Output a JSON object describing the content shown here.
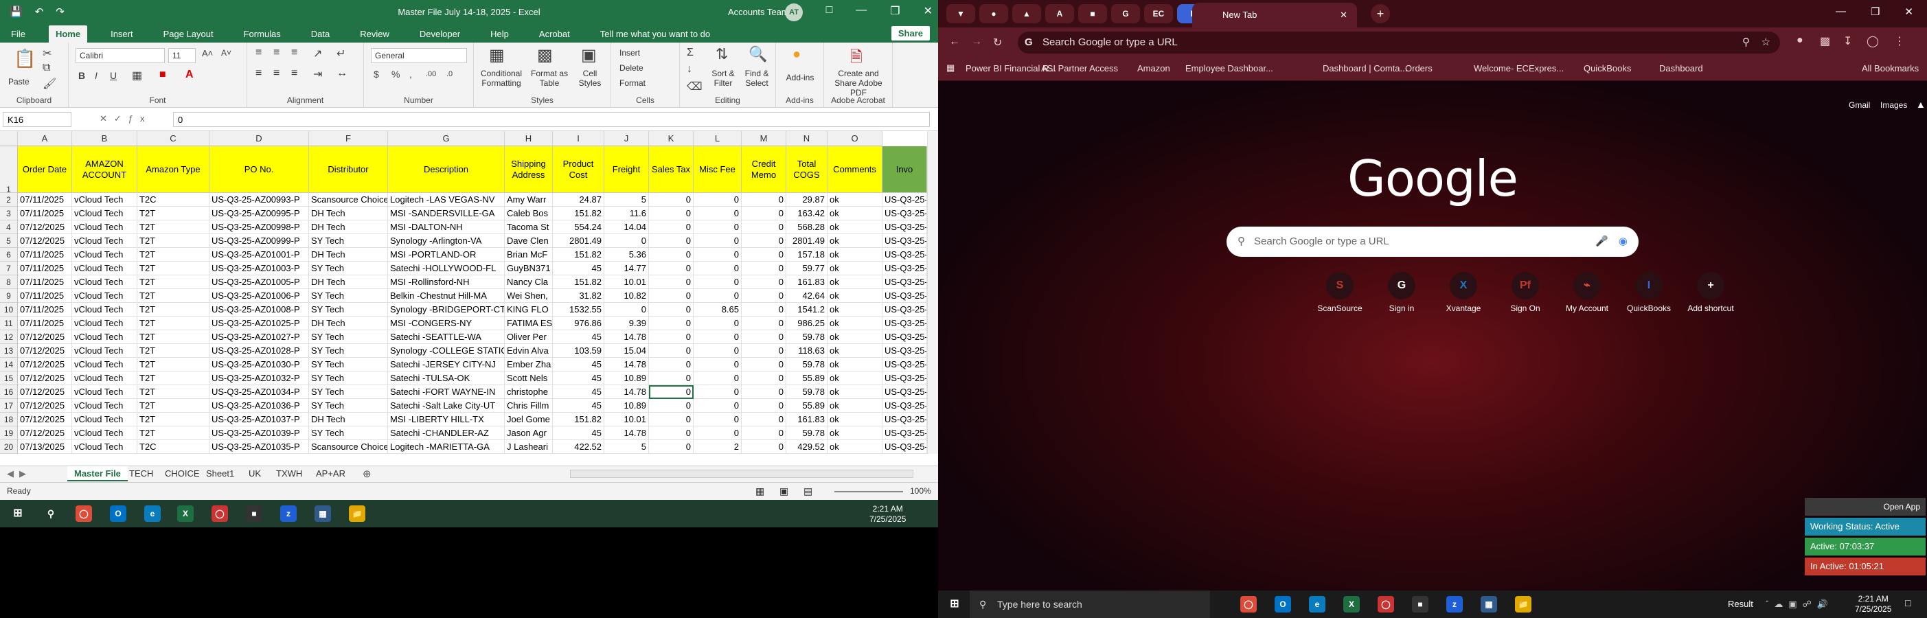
{
  "excel": {
    "title": "Master File July 14-18, 2025  -  Excel",
    "user": "Accounts Team",
    "avatar": "AT",
    "tabs": [
      "File",
      "Home",
      "Insert",
      "Page Layout",
      "Formulas",
      "Data",
      "Review",
      "Developer",
      "Help",
      "Acrobat"
    ],
    "tell_me": "Tell me what you want to do",
    "share": "Share",
    "ribbon": {
      "font": "Calibri",
      "size": "11",
      "number_format": "General",
      "groups": [
        "Clipboard",
        "Font",
        "Alignment",
        "Number",
        "Styles",
        "Cells",
        "Editing",
        "Add-ins",
        "Adobe Acrobat"
      ],
      "buttons": {
        "paste": "Paste",
        "cond": "Conditional Formatting",
        "format_table": "Format as Table",
        "cell_styles": "Cell Styles",
        "insert": "Insert",
        "delete": "Delete",
        "format": "Format",
        "sort": "Sort & Filter",
        "find": "Find & Select",
        "addins": "Add-ins",
        "acrobat": "Create and Share Adobe PDF"
      }
    },
    "namebox": "K16",
    "formula": "0",
    "columns": [
      "A",
      "B",
      "C",
      "D",
      "F",
      "G",
      "H",
      "I",
      "J",
      "K",
      "L",
      "M",
      "N",
      "O"
    ],
    "headers": [
      "Order Date",
      "AMAZON ACCOUNT",
      "Amazon Type",
      "PO No.",
      "Distributor",
      "Description",
      "Shipping Address",
      "Product Cost",
      "Freight",
      "Sales Tax",
      "Misc Fee",
      "Credit Memo",
      "Total COGS",
      "Comments",
      "Invo"
    ],
    "rows": [
      [
        "07/11/2025",
        "vCloud Tech",
        "T2C",
        "US-Q3-25-AZ00993-P",
        "Scansource Choice",
        "Logitech -LAS VEGAS-NV",
        "Amy Warr",
        "24.87",
        "5",
        "0",
        "0",
        "0",
        "29.87",
        "ok",
        "US-Q3-25-A"
      ],
      [
        "07/11/2025",
        "vCloud Tech",
        "T2T",
        "US-Q3-25-AZ00995-P",
        "DH Tech",
        "MSI -SANDERSVILLE-GA",
        "Caleb Bos",
        "151.82",
        "11.6",
        "0",
        "0",
        "0",
        "163.42",
        "ok",
        "US-Q3-25-A"
      ],
      [
        "07/12/2025",
        "vCloud Tech",
        "T2T",
        "US-Q3-25-AZ00998-P",
        "DH Tech",
        "MSI -DALTON-NH",
        "Tacoma St",
        "554.24",
        "14.04",
        "0",
        "0",
        "0",
        "568.28",
        "ok",
        "US-Q3-25-A"
      ],
      [
        "07/12/2025",
        "vCloud Tech",
        "T2T",
        "US-Q3-25-AZ00999-P",
        "SY Tech",
        "Synology -Arlington-VA",
        "Dave Clen",
        "2801.49",
        "0",
        "0",
        "0",
        "0",
        "2801.49",
        "ok",
        "US-Q3-25-A"
      ],
      [
        "07/11/2025",
        "vCloud Tech",
        "T2T",
        "US-Q3-25-AZ01001-P",
        "DH Tech",
        "MSI -PORTLAND-OR",
        "Brian McF",
        "151.82",
        "5.36",
        "0",
        "0",
        "0",
        "157.18",
        "ok",
        "US-Q3-25-A"
      ],
      [
        "07/11/2025",
        "vCloud Tech",
        "T2T",
        "US-Q3-25-AZ01003-P",
        "SY Tech",
        "Satechi -HOLLYWOOD-FL",
        "GuyBN371",
        "45",
        "14.77",
        "0",
        "0",
        "0",
        "59.77",
        "ok",
        "US-Q3-25-A"
      ],
      [
        "07/11/2025",
        "vCloud Tech",
        "T2T",
        "US-Q3-25-AZ01005-P",
        "DH Tech",
        "MSI -Rollinsford-NH",
        "Nancy Cla",
        "151.82",
        "10.01",
        "0",
        "0",
        "0",
        "161.83",
        "ok",
        "US-Q3-25-A"
      ],
      [
        "07/11/2025",
        "vCloud Tech",
        "T2T",
        "US-Q3-25-AZ01006-P",
        "SY Tech",
        "Belkin -Chestnut Hill-MA",
        "Wei Shen,",
        "31.82",
        "10.82",
        "0",
        "0",
        "0",
        "42.64",
        "ok",
        "US-Q3-25-A"
      ],
      [
        "07/11/2025",
        "vCloud Tech",
        "T2T",
        "US-Q3-25-AZ01008-P",
        "SY Tech",
        "Synology -BRIDGEPORT-CT",
        "KING FLO",
        "1532.55",
        "0",
        "0",
        "8.65",
        "0",
        "1541.2",
        "ok",
        "US-Q3-25-A"
      ],
      [
        "07/11/2025",
        "vCloud Tech",
        "T2T",
        "US-Q3-25-AZ01025-P",
        "DH Tech",
        "MSI -CONGERS-NY",
        "FATIMA ES",
        "976.86",
        "9.39",
        "0",
        "0",
        "0",
        "986.25",
        "ok",
        "US-Q3-25-A"
      ],
      [
        "07/12/2025",
        "vCloud Tech",
        "T2T",
        "US-Q3-25-AZ01027-P",
        "SY Tech",
        "Satechi -SEATTLE-WA",
        "Oliver Per",
        "45",
        "14.78",
        "0",
        "0",
        "0",
        "59.78",
        "ok",
        "US-Q3-25-A"
      ],
      [
        "07/12/2025",
        "vCloud Tech",
        "T2T",
        "US-Q3-25-AZ01028-P",
        "SY Tech",
        "Synology -COLLEGE STATION-T",
        "Edvin Alva",
        "103.59",
        "15.04",
        "0",
        "0",
        "0",
        "118.63",
        "ok",
        "US-Q3-25-A"
      ],
      [
        "07/12/2025",
        "vCloud Tech",
        "T2T",
        "US-Q3-25-AZ01030-P",
        "SY Tech",
        "Satechi -JERSEY CITY-NJ",
        "Ember Zha",
        "45",
        "14.78",
        "0",
        "0",
        "0",
        "59.78",
        "ok",
        "US-Q3-25-A"
      ],
      [
        "07/12/2025",
        "vCloud Tech",
        "T2T",
        "US-Q3-25-AZ01032-P",
        "SY Tech",
        "Satechi -TULSA-OK",
        "Scott Nels",
        "45",
        "10.89",
        "0",
        "0",
        "0",
        "55.89",
        "ok",
        "US-Q3-25-A"
      ],
      [
        "07/12/2025",
        "vCloud Tech",
        "T2T",
        "US-Q3-25-AZ01034-P",
        "SY Tech",
        "Satechi -FORT WAYNE-IN",
        "christophe",
        "45",
        "14.78",
        "0",
        "0",
        "0",
        "59.78",
        "ok",
        "US-Q3-25-A"
      ],
      [
        "07/12/2025",
        "vCloud Tech",
        "T2T",
        "US-Q3-25-AZ01036-P",
        "SY Tech",
        "Satechi -Salt Lake City-UT",
        "Chris Fillm",
        "45",
        "10.89",
        "0",
        "0",
        "0",
        "55.89",
        "ok",
        "US-Q3-25-A"
      ],
      [
        "07/12/2025",
        "vCloud Tech",
        "T2T",
        "US-Q3-25-AZ01037-P",
        "DH Tech",
        "MSI -LIBERTY HILL-TX",
        "Joel Gome",
        "151.82",
        "10.01",
        "0",
        "0",
        "0",
        "161.83",
        "ok",
        "US-Q3-25-A"
      ],
      [
        "07/12/2025",
        "vCloud Tech",
        "T2T",
        "US-Q3-25-AZ01039-P",
        "SY Tech",
        "Satechi -CHANDLER-AZ",
        "Jason Agr",
        "45",
        "14.78",
        "0",
        "0",
        "0",
        "59.78",
        "ok",
        "US-Q3-25-A"
      ],
      [
        "07/13/2025",
        "vCloud Tech",
        "T2C",
        "US-Q3-25-AZ01035-P",
        "Scansource Choice",
        "Logitech -MARIETTA-GA",
        "J Lasheari",
        "422.52",
        "5",
        "0",
        "2",
        "0",
        "429.52",
        "ok",
        "US-Q3-25-A"
      ]
    ],
    "row_numbers": [
      "1",
      "2",
      "3",
      "4",
      "5",
      "6",
      "7",
      "8",
      "9",
      "10",
      "11",
      "12",
      "13",
      "14",
      "15",
      "16",
      "17",
      "18",
      "19",
      "20"
    ],
    "sheets": [
      "Master File",
      "TECH",
      "CHOICE",
      "Sheet1",
      "UK",
      "TXWH",
      "AP+AR"
    ],
    "status_ready": "Ready",
    "zoom": "100%",
    "clock_time": "2:21 AM",
    "clock_date": "7/25/2025"
  },
  "chrome": {
    "tab_title": "New Tab",
    "omnibox": "Search Google or type a URL",
    "bookmarks": [
      "Power BI Financial R...",
      "ASI Partner Access",
      "Amazon",
      "Employee Dashboar...",
      "Dashboard | Comta...",
      "Orders",
      "Welcome- ECExpres...",
      "QuickBooks",
      "Dashboard"
    ],
    "all_bookmarks": "All Bookmarks",
    "gmail": "Gmail",
    "images": "Images",
    "logo": "Google",
    "search_placeholder": "Search Google or type a URL",
    "shortcuts": [
      "ScanSource",
      "Sign in",
      "Xvantage",
      "Sign On",
      "My Account",
      "QuickBooks",
      "Add shortcut"
    ],
    "open_app": "Open App",
    "working_status": "Working Status: Active",
    "active": "Active: 07:03:37",
    "inactive": "In Active: 01:05:21",
    "taskbar_search": "Type here to search",
    "result": "Result",
    "clock_time": "2:21 AM",
    "clock_date": "7/25/2025"
  }
}
